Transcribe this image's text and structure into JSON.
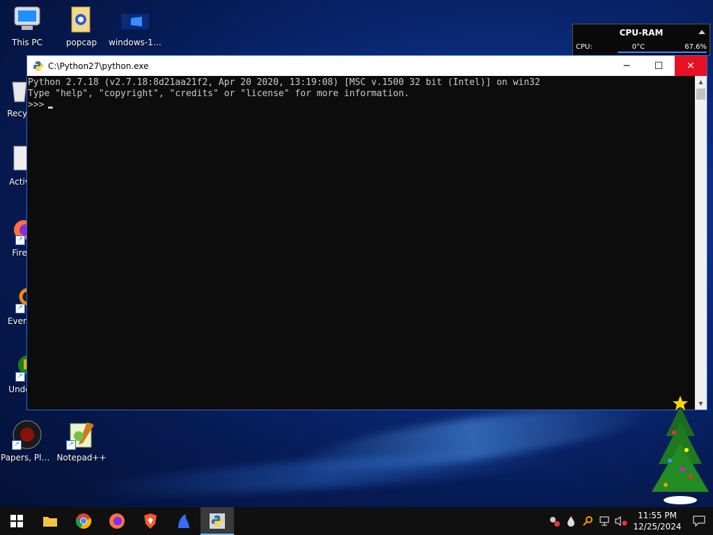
{
  "desktop": {
    "icons": [
      {
        "label": "This PC"
      },
      {
        "label": "popcap"
      },
      {
        "label": "windows-10..."
      },
      {
        "label": "Recyc"
      },
      {
        "label": "Activ"
      },
      {
        "label": "Fire"
      },
      {
        "label": "Every"
      },
      {
        "label": "Unde"
      },
      {
        "label": "Papers, Please"
      },
      {
        "label": "Notepad++"
      }
    ]
  },
  "gadget": {
    "title": "CPU-RAM",
    "cpu_label": "CPU:",
    "temp": "0°C",
    "usage": "67.6%"
  },
  "window": {
    "title": "C:\\Python27\\python.exe",
    "minimize_glyph": "─",
    "maximize_glyph": "☐",
    "close_glyph": "✕",
    "lines": [
      "Python 2.7.18 (v2.7.18:8d21aa21f2, Apr 20 2020, 13:19:08) [MSC v.1500 32 bit (Intel)] on win32",
      "Type \"help\", \"copyright\", \"credits\" or \"license\" for more information.",
      ">>>"
    ]
  },
  "taskbar": {
    "apps": [
      "windows-start-icon",
      "file-explorer-icon",
      "chrome-icon",
      "firefox-icon",
      "brave-icon",
      "app-icon",
      "python-icon"
    ],
    "clock_time": "11:55 PM",
    "clock_date": "12/25/2024"
  },
  "colors": {
    "accent": "#2f68d6",
    "close_red": "#e81123",
    "console_bg": "#0c0c0c",
    "console_fg": "#cccccc"
  }
}
